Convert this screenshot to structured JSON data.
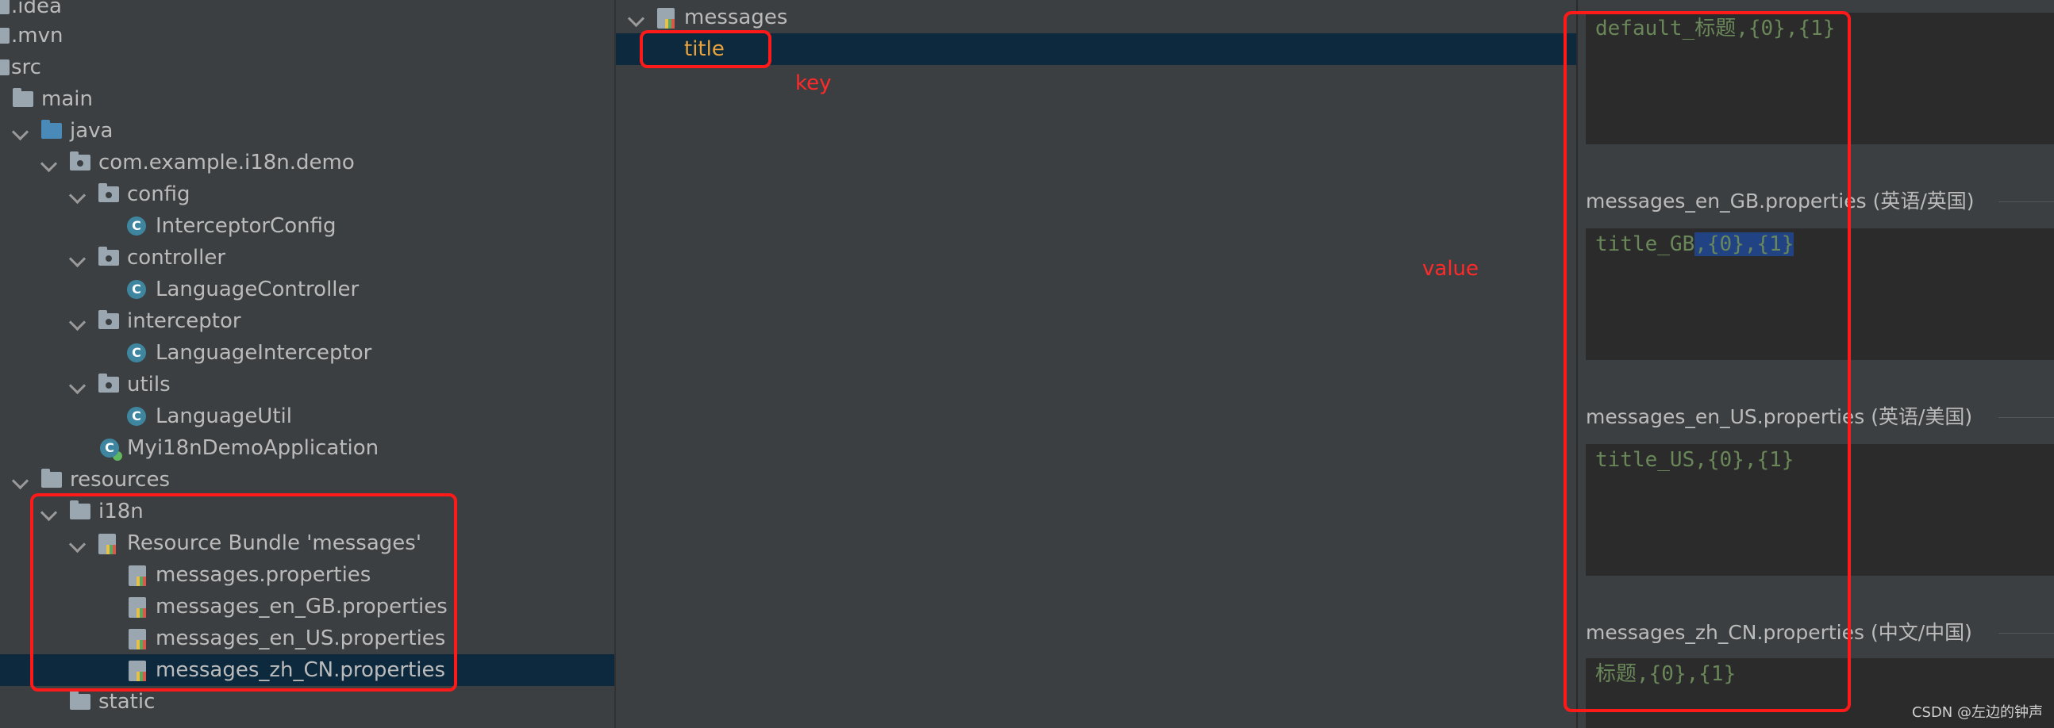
{
  "project_tree": {
    "items": [
      {
        "label": ".idea",
        "kind": "folder"
      },
      {
        "label": ".mvn",
        "kind": "folder"
      },
      {
        "label": "src",
        "kind": "folder"
      },
      {
        "label": "main",
        "kind": "folder"
      },
      {
        "label": "java",
        "kind": "source-folder"
      },
      {
        "label": "com.example.i18n.demo",
        "kind": "package"
      },
      {
        "label": "config",
        "kind": "package"
      },
      {
        "label": "InterceptorConfig",
        "kind": "class"
      },
      {
        "label": "controller",
        "kind": "package"
      },
      {
        "label": "LanguageController",
        "kind": "class"
      },
      {
        "label": "interceptor",
        "kind": "package"
      },
      {
        "label": "LanguageInterceptor",
        "kind": "class"
      },
      {
        "label": "utils",
        "kind": "package"
      },
      {
        "label": "LanguageUtil",
        "kind": "class"
      },
      {
        "label": "Myi18nDemoApplication",
        "kind": "app-class"
      },
      {
        "label": "resources",
        "kind": "resources-folder"
      },
      {
        "label": "i18n",
        "kind": "folder"
      },
      {
        "label": "Resource Bundle 'messages'",
        "kind": "resource-bundle"
      },
      {
        "label": "messages.properties",
        "kind": "properties-file"
      },
      {
        "label": "messages_en_GB.properties",
        "kind": "properties-file"
      },
      {
        "label": "messages_en_US.properties",
        "kind": "properties-file"
      },
      {
        "label": "messages_zh_CN.properties",
        "kind": "properties-file"
      },
      {
        "label": "static",
        "kind": "folder"
      }
    ],
    "class_icon_letter": "C"
  },
  "bundle_keys": {
    "root_label": "messages",
    "selected_key": "title"
  },
  "editor": {
    "default_value": "default_标题,{0},{1}",
    "files": [
      {
        "header": "messages_en_GB.properties (英语/英国)",
        "value_plain": "title_GB",
        "value_selected": ",{0},{1}"
      },
      {
        "header": "messages_en_US.properties (英语/美国)",
        "value": "title_US,{0},{1}"
      },
      {
        "header": "messages_zh_CN.properties (中文/中国)",
        "value": "标题,{0},{1}"
      }
    ]
  },
  "annotations": {
    "key_label": "key",
    "value_label": "value",
    "color": "#ff1a1a"
  },
  "watermark": "CSDN @左边的钟声"
}
